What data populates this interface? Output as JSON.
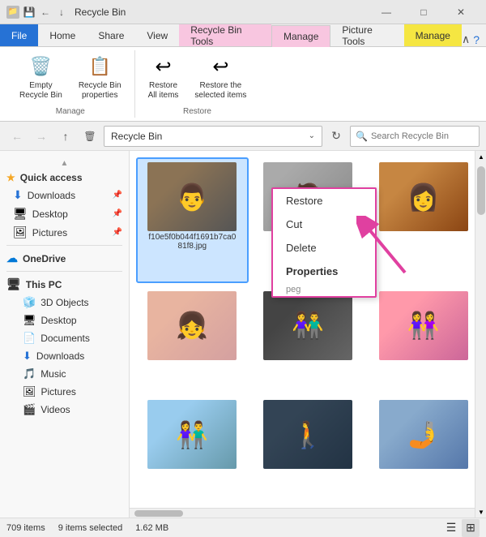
{
  "titlebar": {
    "title": "Recycle Bin",
    "minimize": "—",
    "maximize": "□",
    "close": "✕"
  },
  "tabs": {
    "file": "File",
    "home": "Home",
    "share": "Share",
    "view": "View",
    "manage_tools": "Recycle Bin Tools",
    "manage_active": "Manage",
    "picture_tools": "Picture Tools",
    "manage_picture": "Manage"
  },
  "ribbon": {
    "groups": [
      {
        "label": "Manage",
        "items": [
          {
            "icon": "🗑️",
            "label": "Empty\nRecycle Bin"
          },
          {
            "icon": "📋",
            "label": "Recycle Bin\nproperties"
          }
        ]
      },
      {
        "label": "Restore",
        "items": [
          {
            "icon": "↩️",
            "label": "Restore\nAll items"
          },
          {
            "icon": "↩",
            "label": "Restore the\nselected items"
          }
        ]
      }
    ]
  },
  "addressbar": {
    "path": "Recycle Bin",
    "search_placeholder": "Search Recycle Bin"
  },
  "sidebar": {
    "quickaccess_label": "Quick access",
    "items_quickaccess": [
      {
        "icon": "⬇",
        "label": "Downloads",
        "pin": true
      },
      {
        "icon": "🖥",
        "label": "Desktop",
        "pin": true
      },
      {
        "icon": "🖼",
        "label": "Pictures",
        "pin": true
      }
    ],
    "onedrive_label": "OneDrive",
    "thispc_label": "This PC",
    "items_thispc": [
      {
        "icon": "🧊",
        "label": "3D Objects"
      },
      {
        "icon": "🖥",
        "label": "Desktop"
      },
      {
        "icon": "📄",
        "label": "Documents"
      },
      {
        "icon": "⬇",
        "label": "Downloads"
      },
      {
        "icon": "🎵",
        "label": "Music"
      },
      {
        "icon": "🖼",
        "label": "Pictures"
      },
      {
        "icon": "🎬",
        "label": "Videos"
      }
    ]
  },
  "contextmenu": {
    "items": [
      {
        "label": "Restore",
        "bold": false,
        "highlighted": true
      },
      {
        "label": "Cut",
        "bold": false
      },
      {
        "label": "Delete",
        "bold": false
      },
      {
        "label": "Properties",
        "bold": true
      }
    ],
    "filename": "peg"
  },
  "files": [
    {
      "name": "f10e5f0b044f1691b7ca081f8.jpg",
      "thumb": "1",
      "selected": true
    },
    {
      "name": "",
      "thumb": "2",
      "selected": false
    },
    {
      "name": "",
      "thumb": "3",
      "selected": false
    },
    {
      "name": "",
      "thumb": "4",
      "selected": false
    },
    {
      "name": "",
      "thumb": "5",
      "selected": false
    },
    {
      "name": "",
      "thumb": "6",
      "selected": false
    },
    {
      "name": "",
      "thumb": "7",
      "selected": false
    },
    {
      "name": "",
      "thumb": "8",
      "selected": false
    },
    {
      "name": "",
      "thumb": "9",
      "selected": false
    }
  ],
  "statusbar": {
    "item_count": "709 items",
    "selected_count": "9 items selected",
    "selected_size": "1.62 MB"
  }
}
